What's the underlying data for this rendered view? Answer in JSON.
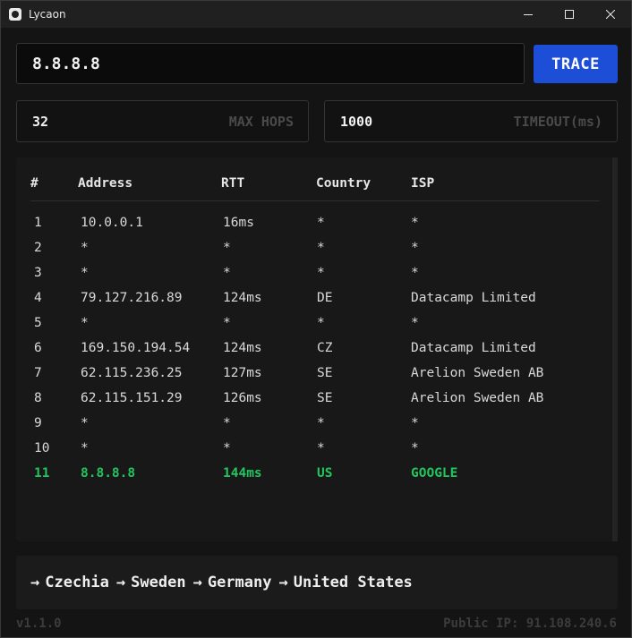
{
  "window": {
    "title": "Lycaon",
    "icon": "app-logo-icon",
    "controls": [
      "minimize-icon",
      "maximize-icon",
      "close-icon"
    ]
  },
  "target": {
    "value": "8.8.8.8",
    "placeholder": ""
  },
  "trace_button": {
    "label": "TRACE",
    "color": "#1d4ed8"
  },
  "options": {
    "max_hops": {
      "value": "32",
      "label": "MAX HOPS"
    },
    "timeout": {
      "value": "1000",
      "label": "TIMEOUT(ms)"
    }
  },
  "table": {
    "headers": {
      "num": "#",
      "address": "Address",
      "rtt": "RTT",
      "country": "Country",
      "isp": "ISP"
    },
    "rows": [
      {
        "num": "1",
        "address": "10.0.0.1",
        "rtt": "16ms",
        "country": "*",
        "isp": "*"
      },
      {
        "num": "2",
        "address": "*",
        "rtt": "*",
        "country": "*",
        "isp": "*"
      },
      {
        "num": "3",
        "address": "*",
        "rtt": "*",
        "country": "*",
        "isp": "*"
      },
      {
        "num": "4",
        "address": "79.127.216.89",
        "rtt": "124ms",
        "country": "DE",
        "isp": "Datacamp Limited"
      },
      {
        "num": "5",
        "address": "*",
        "rtt": "*",
        "country": "*",
        "isp": "*"
      },
      {
        "num": "6",
        "address": "169.150.194.54",
        "rtt": "124ms",
        "country": "CZ",
        "isp": "Datacamp Limited"
      },
      {
        "num": "7",
        "address": "62.115.236.25",
        "rtt": "127ms",
        "country": "SE",
        "isp": "Arelion Sweden AB"
      },
      {
        "num": "8",
        "address": "62.115.151.29",
        "rtt": "126ms",
        "country": "SE",
        "isp": "Arelion Sweden AB"
      },
      {
        "num": "9",
        "address": "*",
        "rtt": "*",
        "country": "*",
        "isp": "*"
      },
      {
        "num": "10",
        "address": "*",
        "rtt": "*",
        "country": "*",
        "isp": "*"
      },
      {
        "num": "11",
        "address": "8.8.8.8",
        "rtt": "144ms",
        "country": "US",
        "isp": "GOOGLE"
      }
    ],
    "final_row_color": "#22c55e"
  },
  "route": {
    "arrow": "→",
    "countries": [
      "Czechia",
      "Sweden",
      "Germany",
      "United States"
    ]
  },
  "footer": {
    "version": "v1.1.0",
    "public_ip": "Public IP: 91.108.240.6"
  }
}
